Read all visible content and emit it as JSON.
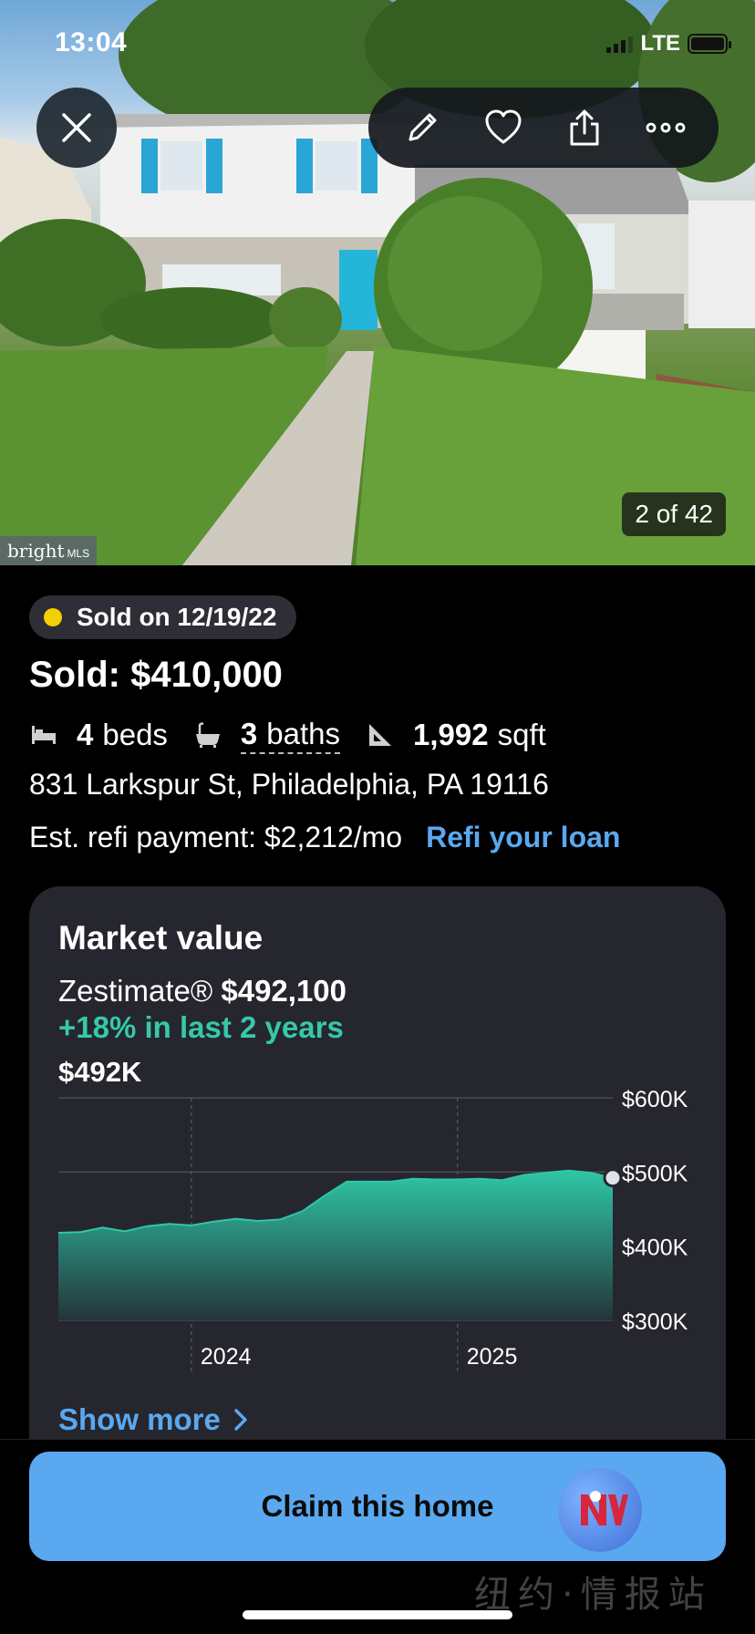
{
  "status_bar": {
    "time": "13:04",
    "network": "LTE"
  },
  "photo": {
    "counter": "2 of 42",
    "source_tag": "bright",
    "source_tag_suffix": "MLS"
  },
  "toolbar": {
    "close": "close-icon",
    "actions": [
      "edit-icon",
      "heart-icon",
      "share-icon",
      "more-icon"
    ]
  },
  "listing": {
    "status": "Sold on 12/19/22",
    "status_color": "#f5d000",
    "price": "Sold: $410,000",
    "beds_value": "4",
    "beds_label": "beds",
    "baths_value": "3",
    "baths_label": "baths",
    "sqft_value": "1,992",
    "sqft_label": "sqft",
    "address": "831 Larkspur St, Philadelphia, PA 19116",
    "refi_payment": "Est. refi payment: $2,212/mo",
    "refi_link": "Refi your loan"
  },
  "market": {
    "title": "Market value",
    "zestimate_label": "Zestimate®",
    "zestimate_value": "$492,100",
    "change": "+18% in last 2 years",
    "current_value": "$492K",
    "show_more": "Show more"
  },
  "chart_data": {
    "type": "area",
    "x_tick_labels": [
      "2024",
      "2025"
    ],
    "y_tick_labels": [
      "$600K",
      "$500K",
      "$400K",
      "$300K"
    ],
    "ylim": [
      300000,
      600000
    ],
    "x_range": [
      "2023-07",
      "2025-08"
    ],
    "grid": true,
    "series": [
      {
        "values": [
          {
            "x": "2023-07",
            "y": 418000
          },
          {
            "x": "2023-08",
            "y": 419000
          },
          {
            "x": "2023-09",
            "y": 425000
          },
          {
            "x": "2023-10",
            "y": 420000
          },
          {
            "x": "2023-11",
            "y": 427000
          },
          {
            "x": "2023-12",
            "y": 430000
          },
          {
            "x": "2024-01",
            "y": 428000
          },
          {
            "x": "2024-02",
            "y": 433000
          },
          {
            "x": "2024-03",
            "y": 437000
          },
          {
            "x": "2024-04",
            "y": 434000
          },
          {
            "x": "2024-05",
            "y": 436000
          },
          {
            "x": "2024-06",
            "y": 447000
          },
          {
            "x": "2024-07",
            "y": 468000
          },
          {
            "x": "2024-08",
            "y": 487000
          },
          {
            "x": "2024-09",
            "y": 487000
          },
          {
            "x": "2024-10",
            "y": 487000
          },
          {
            "x": "2024-11",
            "y": 491000
          },
          {
            "x": "2024-12",
            "y": 490000
          },
          {
            "x": "2025-01",
            "y": 490000
          },
          {
            "x": "2025-02",
            "y": 491000
          },
          {
            "x": "2025-03",
            "y": 489000
          },
          {
            "x": "2025-04",
            "y": 496000
          },
          {
            "x": "2025-05",
            "y": 499000
          },
          {
            "x": "2025-06",
            "y": 502000
          },
          {
            "x": "2025-07",
            "y": 499000
          },
          {
            "x": "2025-08",
            "y": 492100
          }
        ]
      }
    ],
    "colors": {
      "fill_top": "#2fc7a6",
      "fill_bottom": "#263a3c",
      "line": "#2fc7a6"
    }
  },
  "cta": {
    "label": "Claim this home"
  },
  "watermark": "纽约·情报站"
}
